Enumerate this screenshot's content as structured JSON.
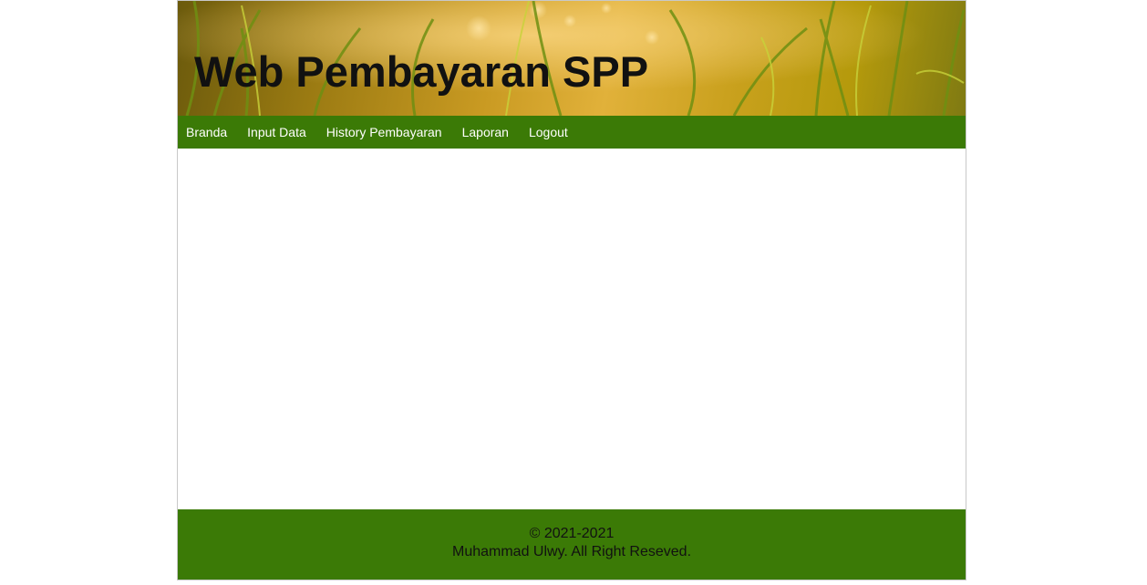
{
  "header": {
    "title": "Web Pembayaran SPP"
  },
  "nav": {
    "items": [
      {
        "label": "Branda"
      },
      {
        "label": "Input Data"
      },
      {
        "label": "History Pembayaran"
      },
      {
        "label": "Laporan"
      },
      {
        "label": "Logout"
      }
    ]
  },
  "footer": {
    "copyright": "© 2021-2021",
    "credit": "Muhammad Ulwy. All Right Reseved."
  },
  "colors": {
    "nav_background": "#3b7a06",
    "footer_background": "#3b7a06",
    "banner_tone": "#c99a22"
  }
}
